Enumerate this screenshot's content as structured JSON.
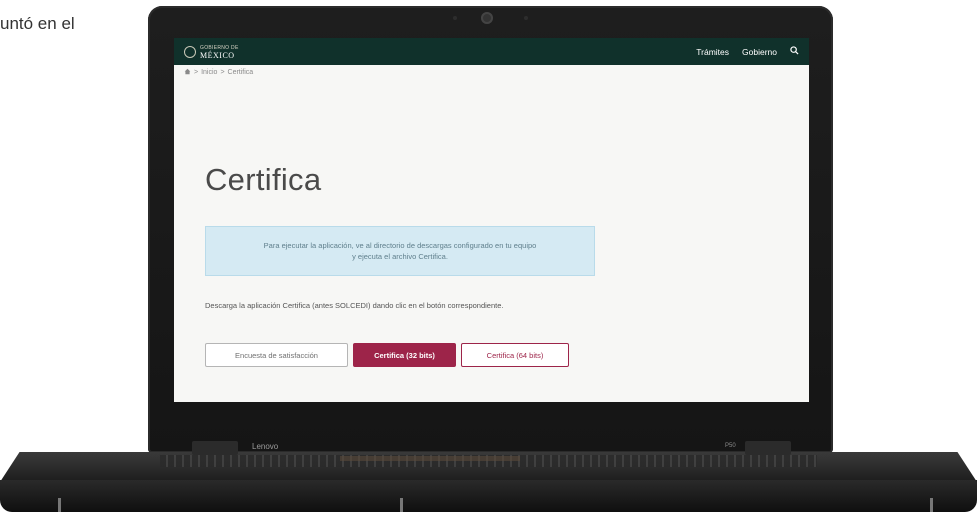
{
  "side_text": "untó en el",
  "device": {
    "brand": "Lenovo",
    "model": "P50"
  },
  "site": {
    "logo_small": "GOBIERNO DE",
    "logo_big": "MÉXICO",
    "nav": [
      "Trámites",
      "Gobierno"
    ]
  },
  "breadcrumb": {
    "home": "Inicio",
    "current": "Certifica"
  },
  "page": {
    "title": "Certifica",
    "alert_line1": "Para ejecutar la aplicación, ve al directorio de descargas configurado en tu equipo",
    "alert_line2": "y ejecuta el archivo Certifica.",
    "description": "Descarga la aplicación Certifica (antes SOLCEDI) dando clic en el botón correspondiente.",
    "buttons": {
      "survey": "Encuesta de satisfacción",
      "bits32": "Certifica (32 bits)",
      "bits64": "Certifica (64 bits)"
    }
  },
  "colors": {
    "topbar": "#10312b",
    "accent": "#9d2449",
    "alert_bg": "#d5eaf3"
  },
  "icons": {
    "search": "search-icon",
    "home": "home-icon"
  }
}
